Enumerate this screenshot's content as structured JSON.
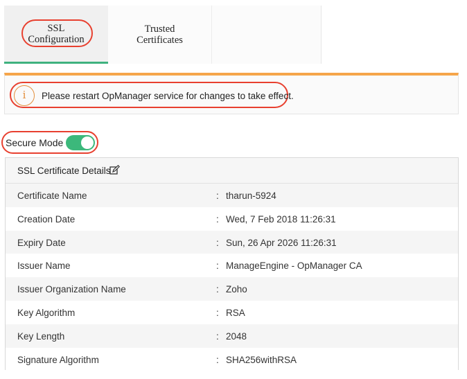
{
  "tabs": [
    {
      "label": "SSL\nConfiguration",
      "active": true
    },
    {
      "label": "Trusted\nCertificates",
      "active": false
    }
  ],
  "notice": {
    "icon": "info-icon",
    "text": "Please restart OpManager service for changes to take effect."
  },
  "secure_mode": {
    "label": "Secure Mode",
    "enabled": true
  },
  "details": {
    "title": "SSL Certificate Details",
    "edit_icon": "edit-icon",
    "separator": ":",
    "rows": [
      {
        "label": "Certificate Name",
        "value": "tharun-5924"
      },
      {
        "label": "Creation Date",
        "value": "Wed, 7 Feb 2018 11:26:31"
      },
      {
        "label": "Expiry Date",
        "value": "Sun, 26 Apr 2026 11:26:31"
      },
      {
        "label": "Issuer Name",
        "value": "ManageEngine - OpManager CA"
      },
      {
        "label": "Issuer Organization Name",
        "value": "Zoho"
      },
      {
        "label": "Key Algorithm",
        "value": "RSA"
      },
      {
        "label": "Key Length",
        "value": "2048"
      },
      {
        "label": "Signature Algorithm",
        "value": "SHA256withRSA"
      }
    ]
  },
  "colors": {
    "accent_green": "#3cb87b",
    "warning_orange": "#f5a54a",
    "highlight_red": "#e8402f"
  }
}
